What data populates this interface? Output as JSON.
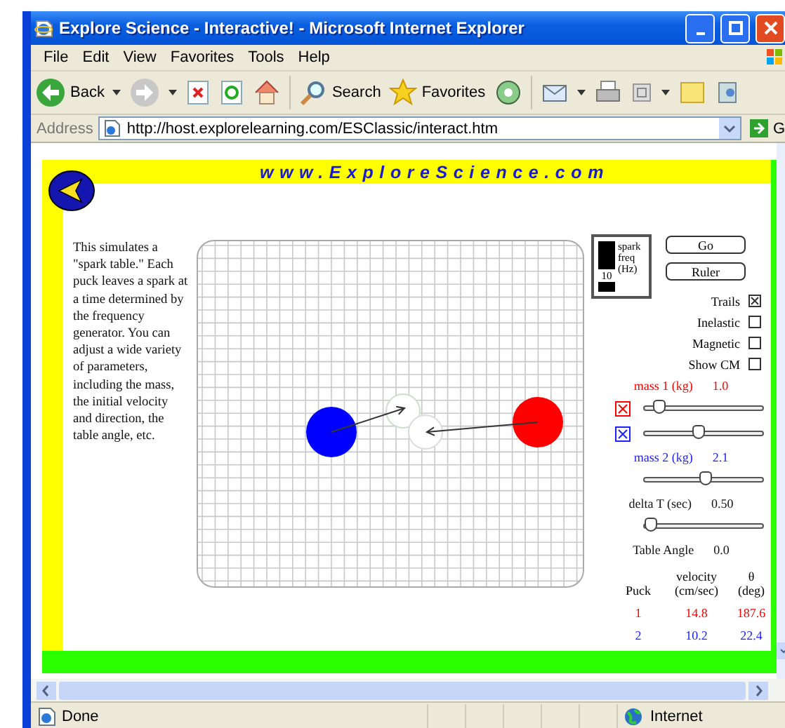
{
  "window": {
    "title": "Explore Science - Interactive! - Microsoft Internet Explorer"
  },
  "menu": [
    "File",
    "Edit",
    "View",
    "Favorites",
    "Tools",
    "Help"
  ],
  "toolbar": {
    "back": "Back",
    "search": "Search",
    "favorites": "Favorites"
  },
  "address": {
    "label": "Address",
    "url": "http://host.explorelearning.com/ESClassic/interact.htm",
    "go": "G"
  },
  "page": {
    "site_title": "www.ExploreScience.com",
    "description": "This simulates a \"spark table.\" Each puck leaves a spark at a time determined by the frequency generator. You can adjust a wide variety of parameters, including the mass, the initial velocity and direction, the table angle, etc.",
    "spark_meter": {
      "label": "spark freq (Hz)",
      "value": "10"
    },
    "buttons": [
      "Go",
      "Ruler"
    ],
    "options": [
      {
        "label": "Trails",
        "checked": true
      },
      {
        "label": "Inelastic",
        "checked": false
      },
      {
        "label": "Magnetic",
        "checked": false
      },
      {
        "label": "Show CM",
        "checked": false
      }
    ],
    "controls": [
      {
        "kind": "reading",
        "label": "mass 1 (kg)",
        "value": "1.0",
        "color": "#ff0000"
      },
      {
        "kind": "slider",
        "color": "#ff0000",
        "checked": true,
        "level": 0.08
      },
      {
        "kind": "slider",
        "color": "#2020ff",
        "checked": true,
        "level": 0.45
      },
      {
        "kind": "reading",
        "label": "mass 2 (kg)",
        "value": "2.1",
        "color": "#2020ff"
      },
      {
        "kind": "slider",
        "level": 0.52
      },
      {
        "kind": "reading",
        "label": "delta T (sec)",
        "value": "0.50"
      },
      {
        "kind": "slider",
        "level": 0
      },
      {
        "kind": "reading",
        "label": "Table Angle",
        "value": "0.0"
      }
    ],
    "results": {
      "columns": [
        "Puck",
        "velocity (cm/sec)",
        "θ (deg)"
      ],
      "rows": [
        {
          "cells": [
            "1",
            "14.8",
            "187.6"
          ],
          "color": "#ff0000"
        },
        {
          "cells": [
            "2",
            "10.2",
            "22.4"
          ],
          "color": "#2020ff"
        }
      ]
    }
  },
  "status_bar": {
    "text": "Done",
    "zone": "Internet"
  }
}
